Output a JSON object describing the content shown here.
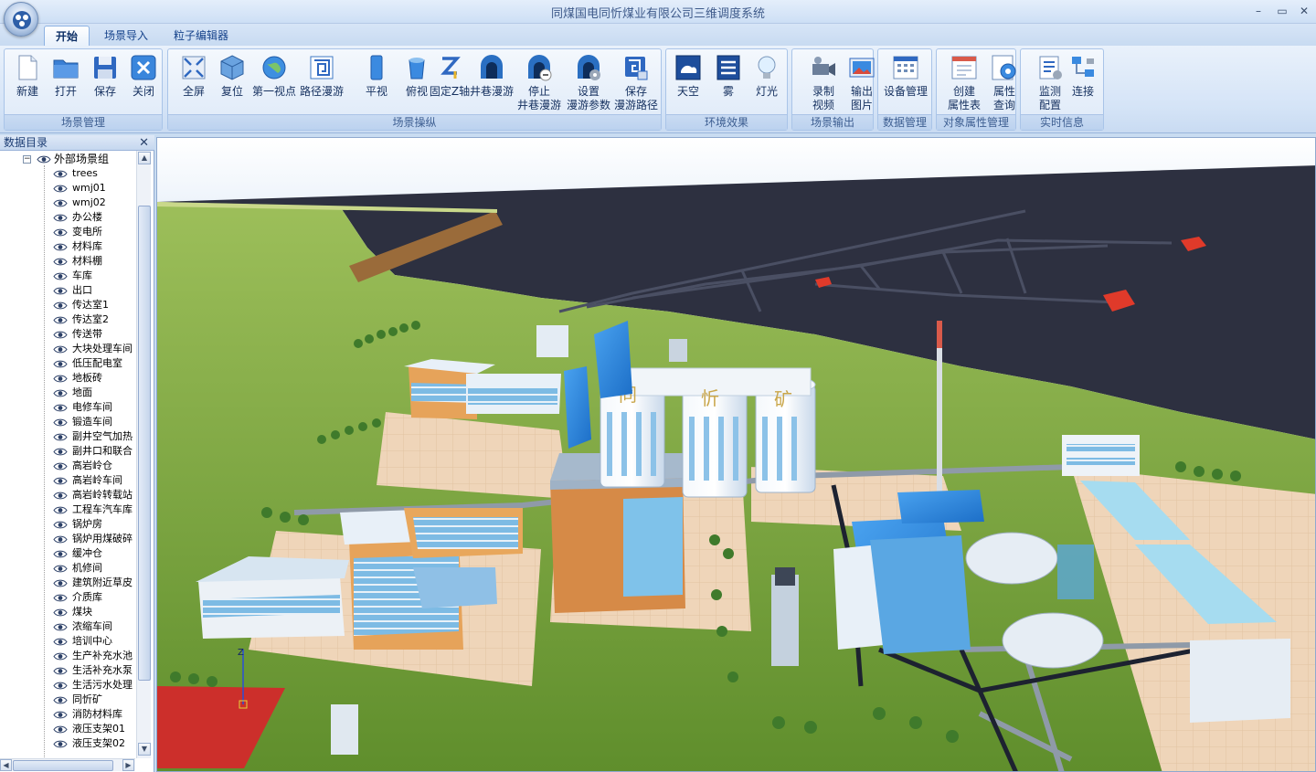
{
  "window": {
    "title": "同煤国电同忻煤业有限公司三维调度系统",
    "minimize": "–",
    "restore": "▭",
    "close": "✕"
  },
  "tabs": [
    "开始",
    "场景导入",
    "粒子编辑器"
  ],
  "ribbon": {
    "groups": [
      {
        "label": "场景管理",
        "buttons": [
          {
            "label": "新建",
            "icon": "new-file-icon"
          },
          {
            "label": "打开",
            "icon": "folder-open-icon"
          },
          {
            "label": "保存",
            "icon": "save-disk-icon"
          },
          {
            "label": "关闭",
            "icon": "close-x-icon"
          }
        ]
      },
      {
        "label": "场景操纵",
        "buttons": [
          {
            "label": "全屏",
            "icon": "fullscreen-icon"
          },
          {
            "label": "复位",
            "icon": "reset-cube-icon"
          },
          {
            "label": "第一视点",
            "icon": "globe-icon"
          },
          {
            "label": "路径漫游",
            "icon": "path-spiral-icon"
          },
          {
            "label": "平视",
            "icon": "level-view-icon"
          },
          {
            "label": "俯视",
            "icon": "top-view-icon"
          },
          {
            "label": "固定Z轴",
            "icon": "z-axis-icon"
          },
          {
            "label": "井巷漫游",
            "icon": "tunnel-icon"
          },
          {
            "label": "停止\n井巷漫游",
            "icon": "tunnel-stop-icon"
          },
          {
            "label": "设置\n漫游参数",
            "icon": "tunnel-settings-icon"
          },
          {
            "label": "保存\n漫游路径",
            "icon": "save-path-icon"
          }
        ]
      },
      {
        "label": "环境效果",
        "buttons": [
          {
            "label": "天空",
            "icon": "sky-icon"
          },
          {
            "label": "雾",
            "icon": "fog-icon"
          },
          {
            "label": "灯光",
            "icon": "lightbulb-icon"
          }
        ]
      },
      {
        "label": "场景输出",
        "buttons": [
          {
            "label": "录制\n视频",
            "icon": "video-camera-icon"
          },
          {
            "label": "输出\n图片",
            "icon": "export-image-icon"
          }
        ]
      },
      {
        "label": "数据管理",
        "buttons": [
          {
            "label": "设备管理",
            "icon": "device-grid-icon"
          }
        ]
      },
      {
        "label": "对象属性管理",
        "buttons": [
          {
            "label": "创建\n属性表",
            "icon": "create-table-icon"
          },
          {
            "label": "属性\n查询",
            "icon": "query-gear-icon"
          }
        ]
      },
      {
        "label": "实时信息",
        "buttons": [
          {
            "label": "监测\n配置",
            "icon": "monitor-config-icon"
          },
          {
            "label": "连接",
            "icon": "network-connect-icon"
          }
        ]
      }
    ]
  },
  "leftpanel": {
    "title": "数据目录",
    "close": "✕",
    "root": {
      "label": "外部场景组",
      "expander": "−"
    },
    "items": [
      "trees",
      "wmj01",
      "wmj02",
      "办公楼",
      "变电所",
      "材料库",
      "材料棚",
      "车库",
      "出口",
      "传达室1",
      "传达室2",
      "传送带",
      "大块处理车间",
      "低压配电室",
      "地板砖",
      "地面",
      "电修车间",
      "锻造车间",
      "副井空气加热",
      "副井口和联合",
      "高岩岭仓",
      "高岩岭车间",
      "高岩岭转载站",
      "工程车汽车库",
      "锅炉房",
      "锅炉用煤破碎",
      "缓冲仓",
      "机修间",
      "建筑附近草皮",
      "介质库",
      "煤块",
      "浓缩车间",
      "培训中心",
      "生产补充水池",
      "生活补充水泵",
      "生活污水处理",
      "同忻矿",
      "消防材料库",
      "液压支架01",
      "液压支架02"
    ]
  },
  "scene": {
    "silo_text": [
      "同",
      "忻",
      "矿"
    ],
    "axis_label": "Z"
  }
}
